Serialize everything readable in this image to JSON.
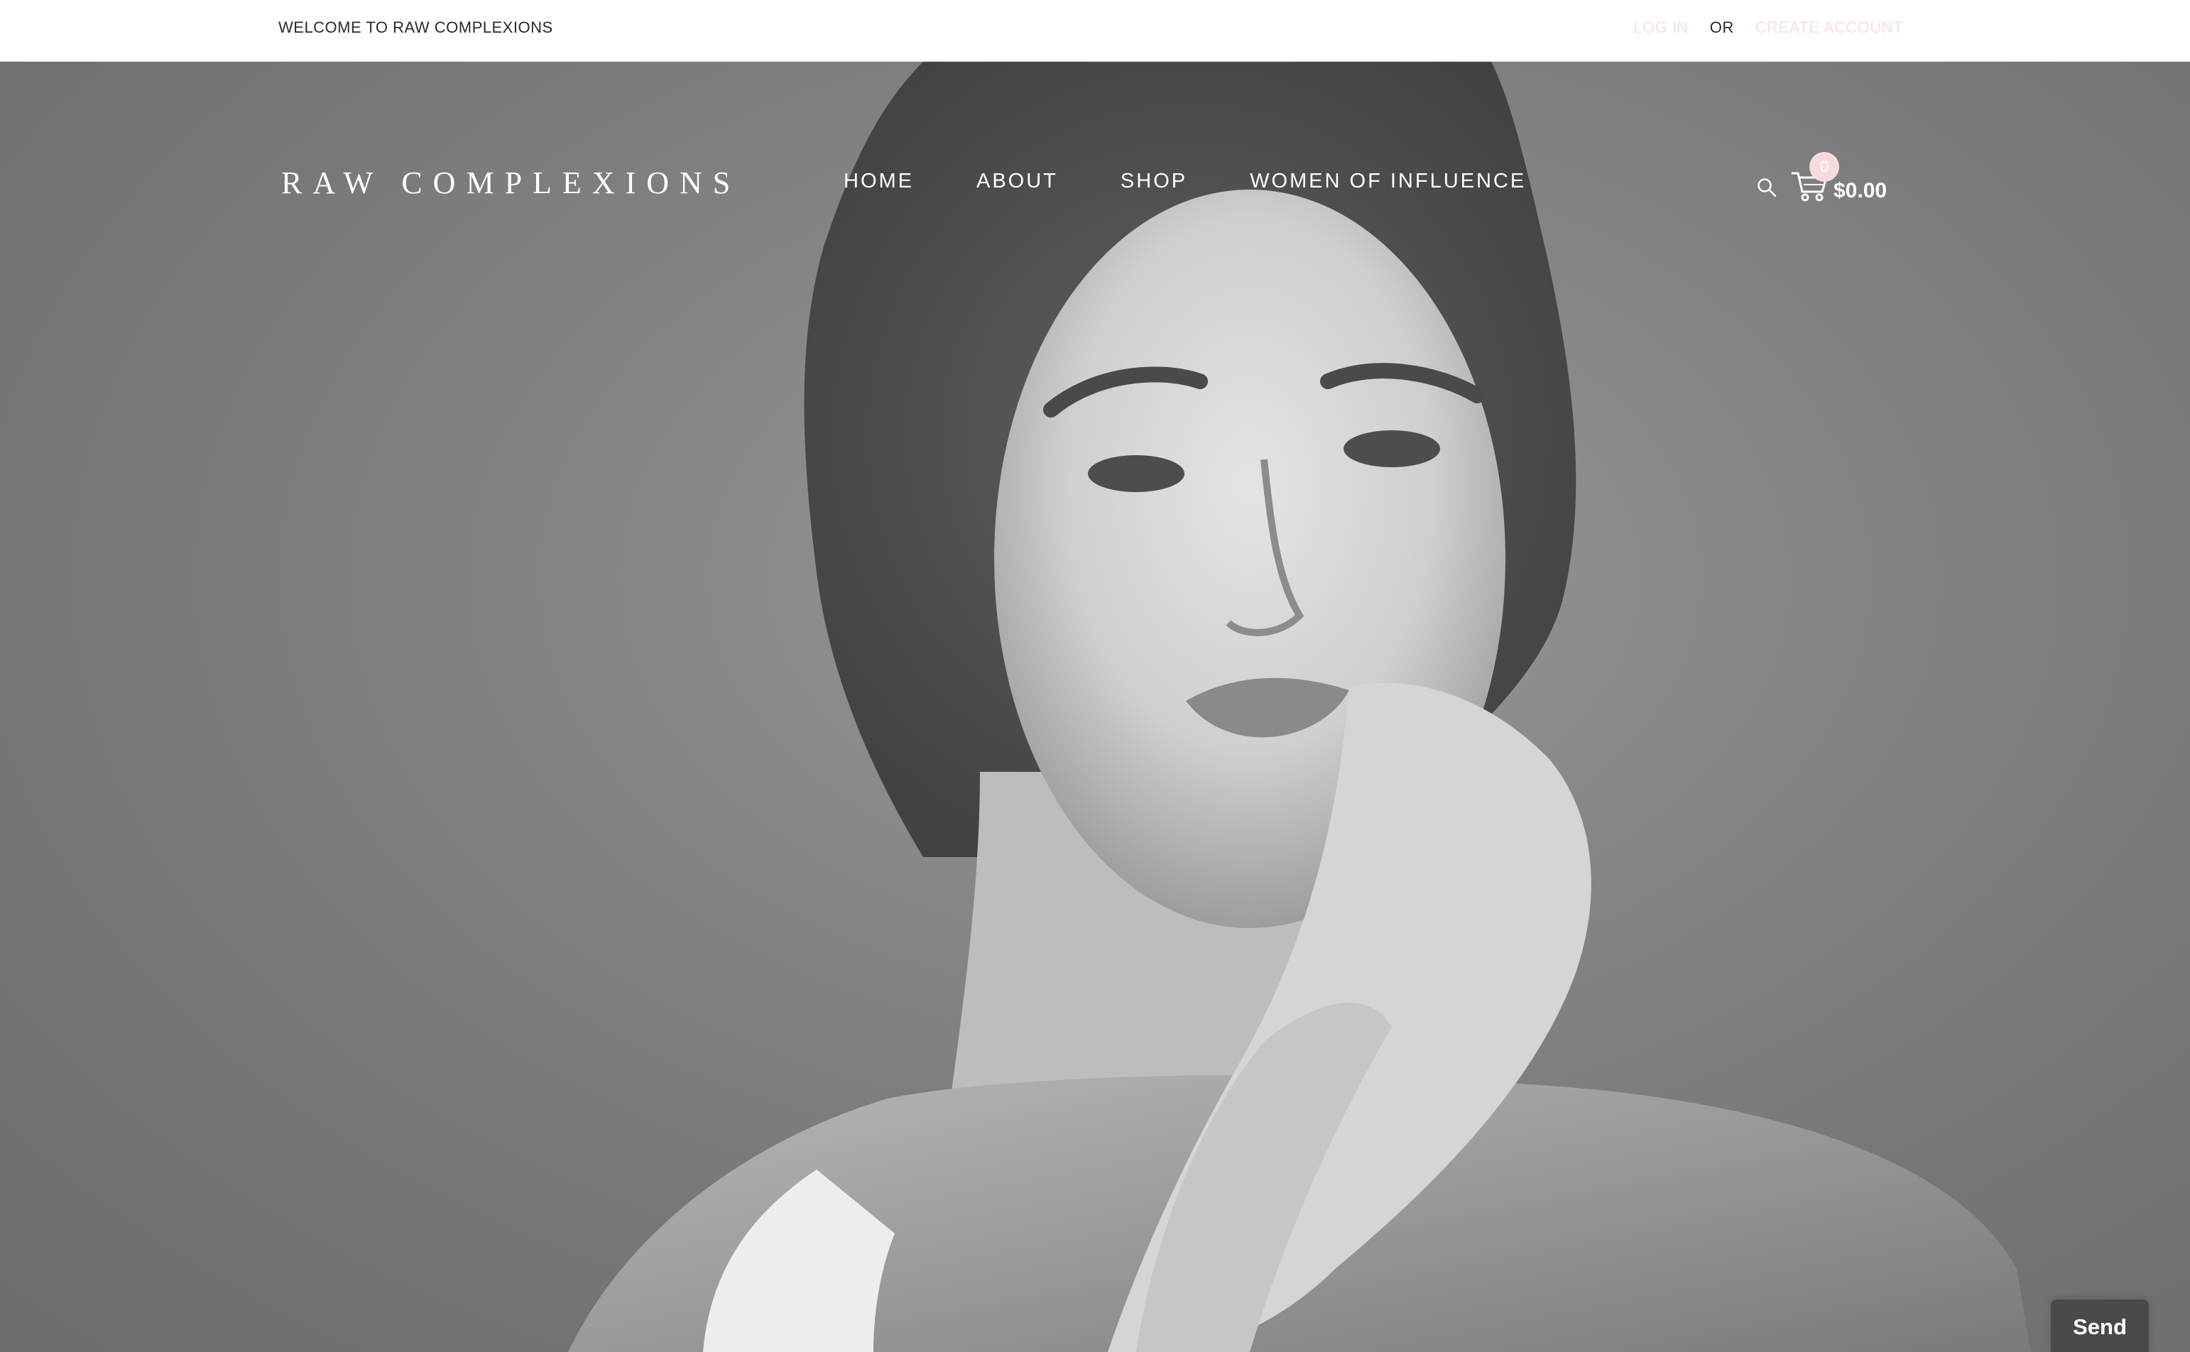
{
  "topbar": {
    "welcome": "WELCOME TO RAW COMPLEXIONS",
    "login_label": "LOG IN",
    "or_label": "OR",
    "create_account_label": "CREATE ACCOUNT"
  },
  "header": {
    "logo": "RAW COMPLEXIONS",
    "nav": {
      "home": "HOME",
      "about": "ABOUT",
      "shop": "SHOP",
      "women_of_influence": "WOMEN OF INFLUENCE"
    },
    "cart": {
      "count": "0",
      "total": "$0.00"
    }
  },
  "chat": {
    "send_label": "Send"
  },
  "icons": {
    "search": "search-icon",
    "cart": "shopping-cart-icon"
  },
  "colors": {
    "accent_pink": "#f6dede",
    "hero_gray": "#858585",
    "send_button": "#4a4a4a"
  }
}
